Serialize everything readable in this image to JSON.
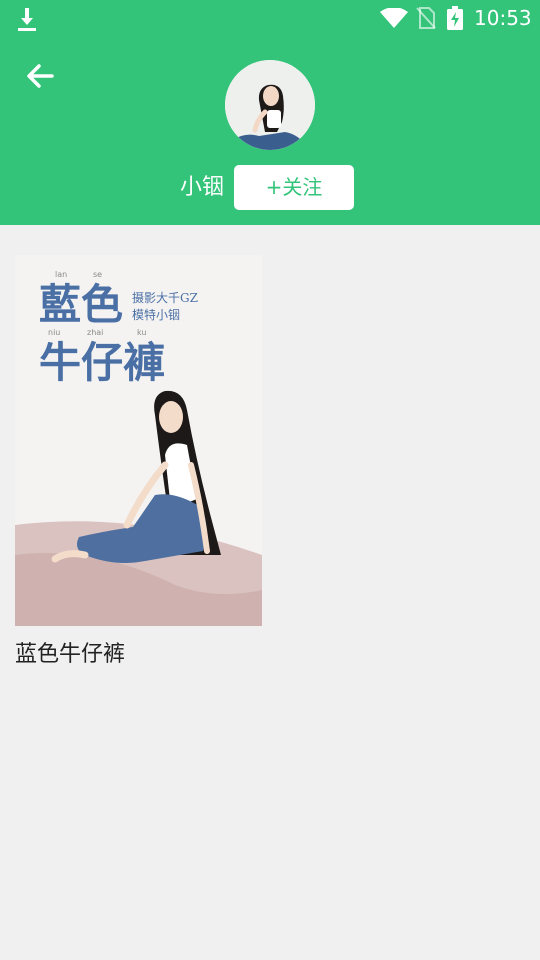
{
  "status_bar": {
    "time": "10:53",
    "icons": [
      "download-icon",
      "wifi-icon",
      "no-sim-icon",
      "battery-charging-icon"
    ]
  },
  "header": {
    "back_icon": "arrow-left-icon",
    "nickname": "小铟",
    "follow_label": "+关注",
    "accent_color": "#33c47a"
  },
  "albums": [
    {
      "title": "蓝色牛仔裤",
      "cover": {
        "title_pinyin": [
          "lan",
          "se",
          "niu",
          "zhai",
          "ku"
        ],
        "title_line1": "藍色",
        "title_line2": "牛仔褲",
        "credit_line1": "摄影大千GZ",
        "credit_line2": "模特小铟"
      }
    }
  ]
}
